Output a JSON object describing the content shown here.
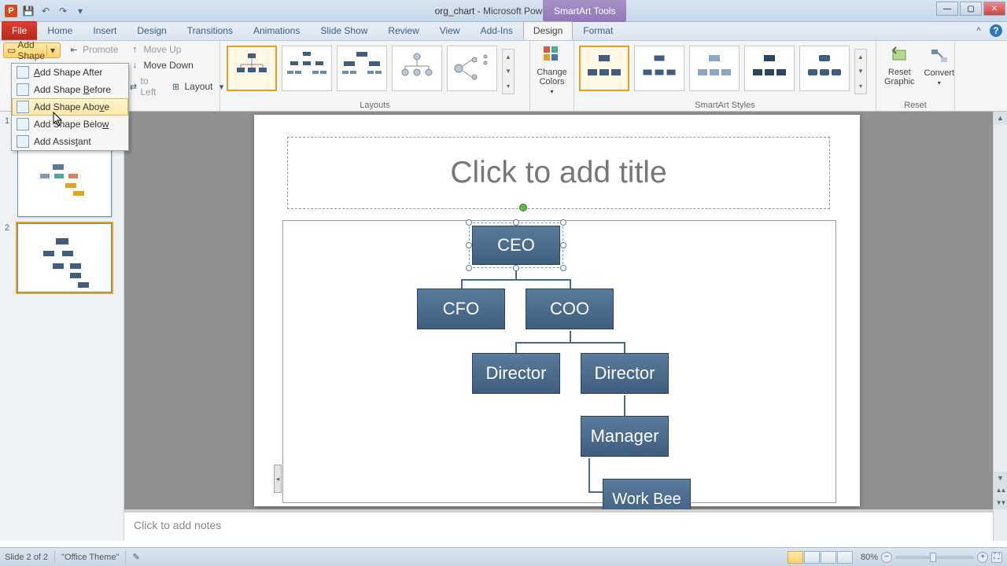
{
  "title": {
    "doc": "org_chart",
    "app": "Microsoft PowerPoint",
    "context": "SmartArt Tools"
  },
  "qat": {
    "save": "💾",
    "undo": "↶",
    "redo": "↷",
    "more": "▾"
  },
  "tabs": [
    "File",
    "Home",
    "Insert",
    "Design",
    "Transitions",
    "Animations",
    "Slide Show",
    "Review",
    "View",
    "Add-Ins",
    "Design",
    "Format"
  ],
  "ribbon": {
    "add_shape": "Add Shape",
    "promote": "Promote",
    "move_up": "Move Up",
    "move_down": "Move Down",
    "to_left": "to Left",
    "layout": "Layout",
    "layouts_label": "Layouts",
    "change_colors": "Change\nColors",
    "styles_label": "SmartArt Styles",
    "reset_graphic": "Reset\nGraphic",
    "convert": "Convert",
    "reset_label": "Reset"
  },
  "dropdown": {
    "after": "Add Shape After",
    "before": "Add Shape Before",
    "above": "Add Shape Above",
    "below": "Add Shape Below",
    "assistant": "Add Assistant"
  },
  "slides": {
    "1": "1",
    "2": "2"
  },
  "canvas": {
    "title_placeholder": "Click to add title",
    "ceo": "CEO",
    "cfo": "CFO",
    "coo": "COO",
    "dir1": "Director",
    "dir2": "Director",
    "manager": "Manager",
    "workbee": "Work Bee"
  },
  "notes": "Click to add notes",
  "status": {
    "slide": "Slide 2 of 2",
    "theme": "\"Office Theme\"",
    "zoom": "80%"
  }
}
